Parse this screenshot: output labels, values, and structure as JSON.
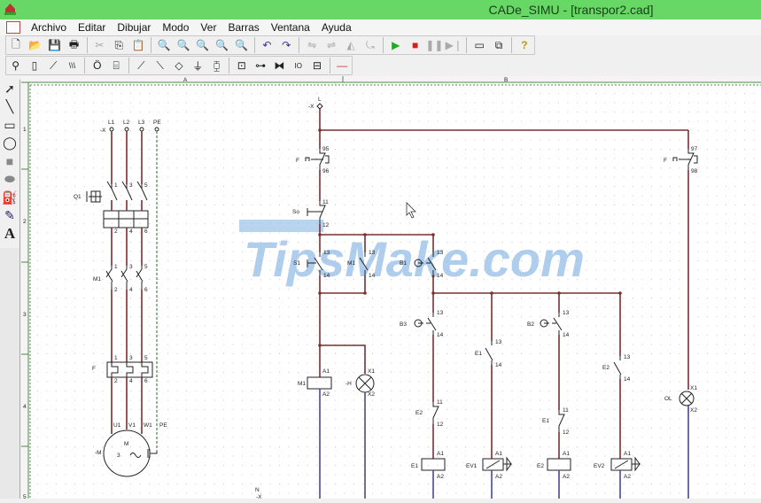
{
  "window": {
    "title": "CADe_SIMU - [transpor2.cad]"
  },
  "menu": [
    "Archivo",
    "Editar",
    "Dibujar",
    "Modo",
    "Ver",
    "Barras",
    "Ventana",
    "Ayuda"
  ],
  "toolbar1": {
    "icons": [
      "new-icon",
      "open-icon",
      "save-icon",
      "print-icon",
      "cut-icon",
      "copy-icon",
      "paste-icon",
      "zoom-in-icon",
      "zoom-out-icon",
      "zoom-window-icon",
      "zoom-all-icon",
      "zoom-previous-icon",
      "undo-icon",
      "redo-icon",
      "mirror-icon",
      "align-icon",
      "flip-icon",
      "rotate-icon",
      "play-icon",
      "stop-icon",
      "pause-icon",
      "step-icon",
      "window-icon",
      "cascade-icon",
      "help-icon"
    ]
  },
  "toolbar2": {
    "icons": [
      "supply-icon",
      "fuse-icon",
      "switch-icon",
      "three-phase-switch-icon",
      "motor-icon",
      "component-icon",
      "contact-no-icon",
      "contact-nc-icon",
      "pushbutton-icon",
      "coil-icon",
      "relay-icon",
      "plc-icon",
      "timer-icon",
      "valve-icon",
      "io-icon",
      "bus-icon",
      "line-icon"
    ]
  },
  "toolbox": [
    "select-tool",
    "line-tool",
    "rectangle-tool",
    "ellipse-tool",
    "filled-rectangle-tool",
    "filled-ellipse-tool",
    "fill-tool",
    "color-picker-tool",
    "text-tool"
  ],
  "watermark": "TipsMake.com",
  "ruler": {
    "cols": [
      "A",
      "B"
    ],
    "rows": [
      "1",
      "2",
      "3",
      "4",
      "5"
    ]
  },
  "power": {
    "X": "-X",
    "L1": "L1",
    "L2": "L2",
    "L3": "L3",
    "PE": "PE",
    "Q1": "Q1",
    "M1": "M1",
    "F": "F",
    "M": "-M",
    "motor_m": "M",
    "motor_3": "3",
    "U1": "U1",
    "V1": "V1",
    "W1": "W1",
    "PE2": "PE",
    "n1": "1",
    "n3": "3",
    "n5": "5",
    "n2": "2",
    "n4": "4",
    "n6": "6"
  },
  "control": {
    "X": "-X",
    "L": "L",
    "N": "N",
    "F": "F",
    "F95": "95",
    "F96": "96",
    "F97": "97",
    "F98": "98",
    "So": "So",
    "n11": "11",
    "n12": "12",
    "n13": "13",
    "n14": "14",
    "S1": "S1",
    "M1": "M1",
    "B1": "B1",
    "B3": "B3",
    "B2": "B2",
    "E1": "E1",
    "E2": "E2",
    "EV1": "EV1",
    "EV2": "EV2",
    "H": "-H",
    "OL": "OL",
    "A1": "A1",
    "A2": "A2",
    "X1": "X1",
    "X2": "X2"
  }
}
